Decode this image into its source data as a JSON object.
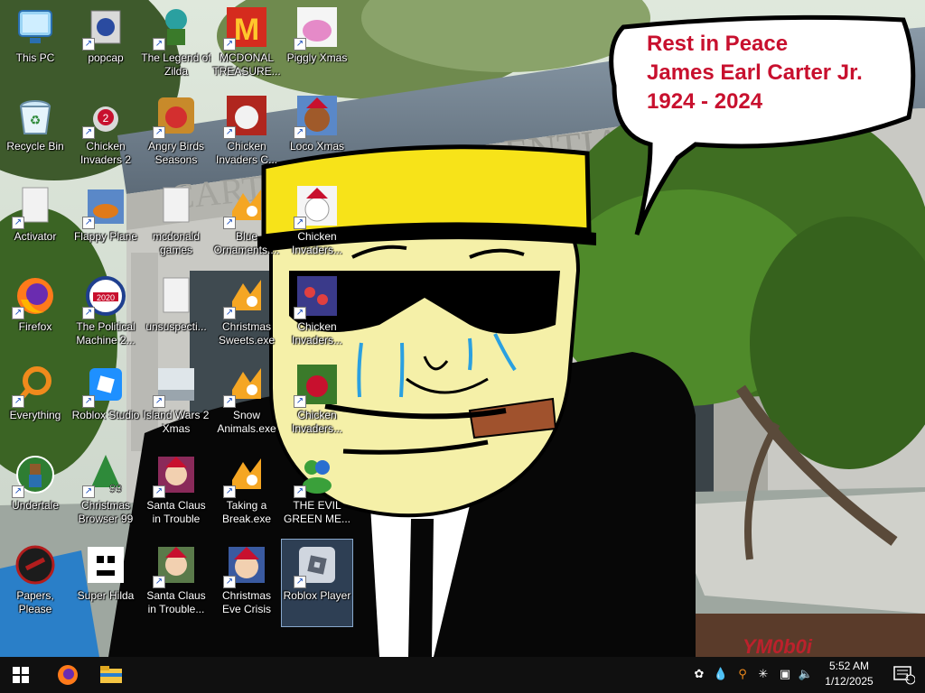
{
  "desktop": {
    "icons": [
      {
        "label": "This PC"
      },
      {
        "label": "popcap"
      },
      {
        "label": "The Legend of Zilda"
      },
      {
        "label": "MCDONAL TREASURE..."
      },
      {
        "label": "Piggly Xmas"
      },
      {
        "label": "Recycle Bin"
      },
      {
        "label": "Chicken Invaders 2"
      },
      {
        "label": "Angry Birds Seasons"
      },
      {
        "label": "Chicken Invaders C..."
      },
      {
        "label": "Loco Xmas"
      },
      {
        "label": "Activator"
      },
      {
        "label": "Flappy Plane"
      },
      {
        "label": "mcdonald games"
      },
      {
        "label": "Blue Ornaments...."
      },
      {
        "label": "Chicken Invaders..."
      },
      {
        "label": "Firefox"
      },
      {
        "label": "The Political Machine 2..."
      },
      {
        "label": "unsuspecti..."
      },
      {
        "label": "Christmas Sweets.exe"
      },
      {
        "label": "Chicken Invaders..."
      },
      {
        "label": "Everything"
      },
      {
        "label": "Roblox Studio"
      },
      {
        "label": "Island Wars 2 Xmas"
      },
      {
        "label": "Snow Animals.exe"
      },
      {
        "label": "Chicken Invaders..."
      },
      {
        "label": "Undertale"
      },
      {
        "label": "Christmas Browser 99"
      },
      {
        "label": "Santa Claus in Trouble"
      },
      {
        "label": "Taking a Break.exe"
      },
      {
        "label": "THE EVIL GREEN ME..."
      },
      {
        "label": "Papers, Please"
      },
      {
        "label": "Super Hilda"
      },
      {
        "label": "Santa Claus in Trouble... A..."
      },
      {
        "label": "Christmas Eve Crisis"
      },
      {
        "label": "Roblox Player"
      }
    ]
  },
  "wallpaper": {
    "speech_bubble": {
      "line1": "Rest in Peace",
      "line2": "James Earl Carter Jr.",
      "line3": "1924 - 2024"
    },
    "building_sign": "ENTIAL",
    "building_sign2": "CART",
    "watermark": "YM0b0i"
  },
  "taskbar": {
    "clock_time": "5:52 AM",
    "clock_date": "1/12/2025",
    "notification_count": "1"
  }
}
